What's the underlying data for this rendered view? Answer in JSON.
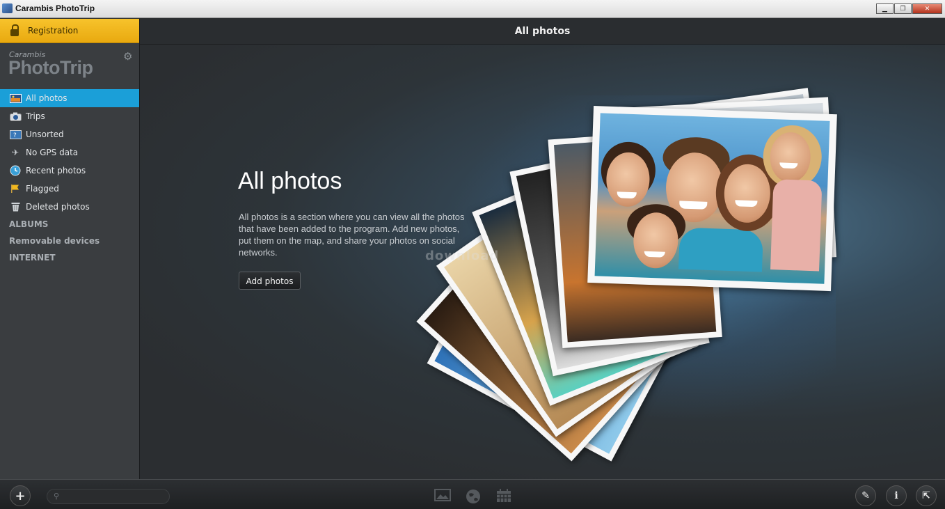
{
  "window": {
    "title": "Carambis PhotoTrip"
  },
  "sidebar": {
    "registration_label": "Registration",
    "brand_small": "Carambis",
    "brand_big": "PhotoTrip",
    "items": [
      {
        "label": "All photos",
        "icon": "photo-icon"
      },
      {
        "label": "Trips",
        "icon": "camera-icon"
      },
      {
        "label": "Unsorted",
        "icon": "unsorted-icon"
      },
      {
        "label": "No GPS data",
        "icon": "satellite-icon"
      },
      {
        "label": "Recent photos",
        "icon": "clock-icon"
      },
      {
        "label": "Flagged",
        "icon": "flag-icon"
      },
      {
        "label": "Deleted photos",
        "icon": "trash-icon"
      }
    ],
    "sections": [
      "ALBUMS",
      "Removable devices",
      "INTERNET"
    ]
  },
  "main": {
    "header": "All photos",
    "heading": "All photos",
    "description": "All photos is a section where you can view all the photos that have been added to the program. Add new photos, put them on the map, and share your photos on social networks.",
    "add_button": "Add photos",
    "watermark": "download"
  },
  "colors": {
    "accent": "#1b9fd8",
    "registration": "#f2b81e",
    "background": "#2b2e31"
  }
}
